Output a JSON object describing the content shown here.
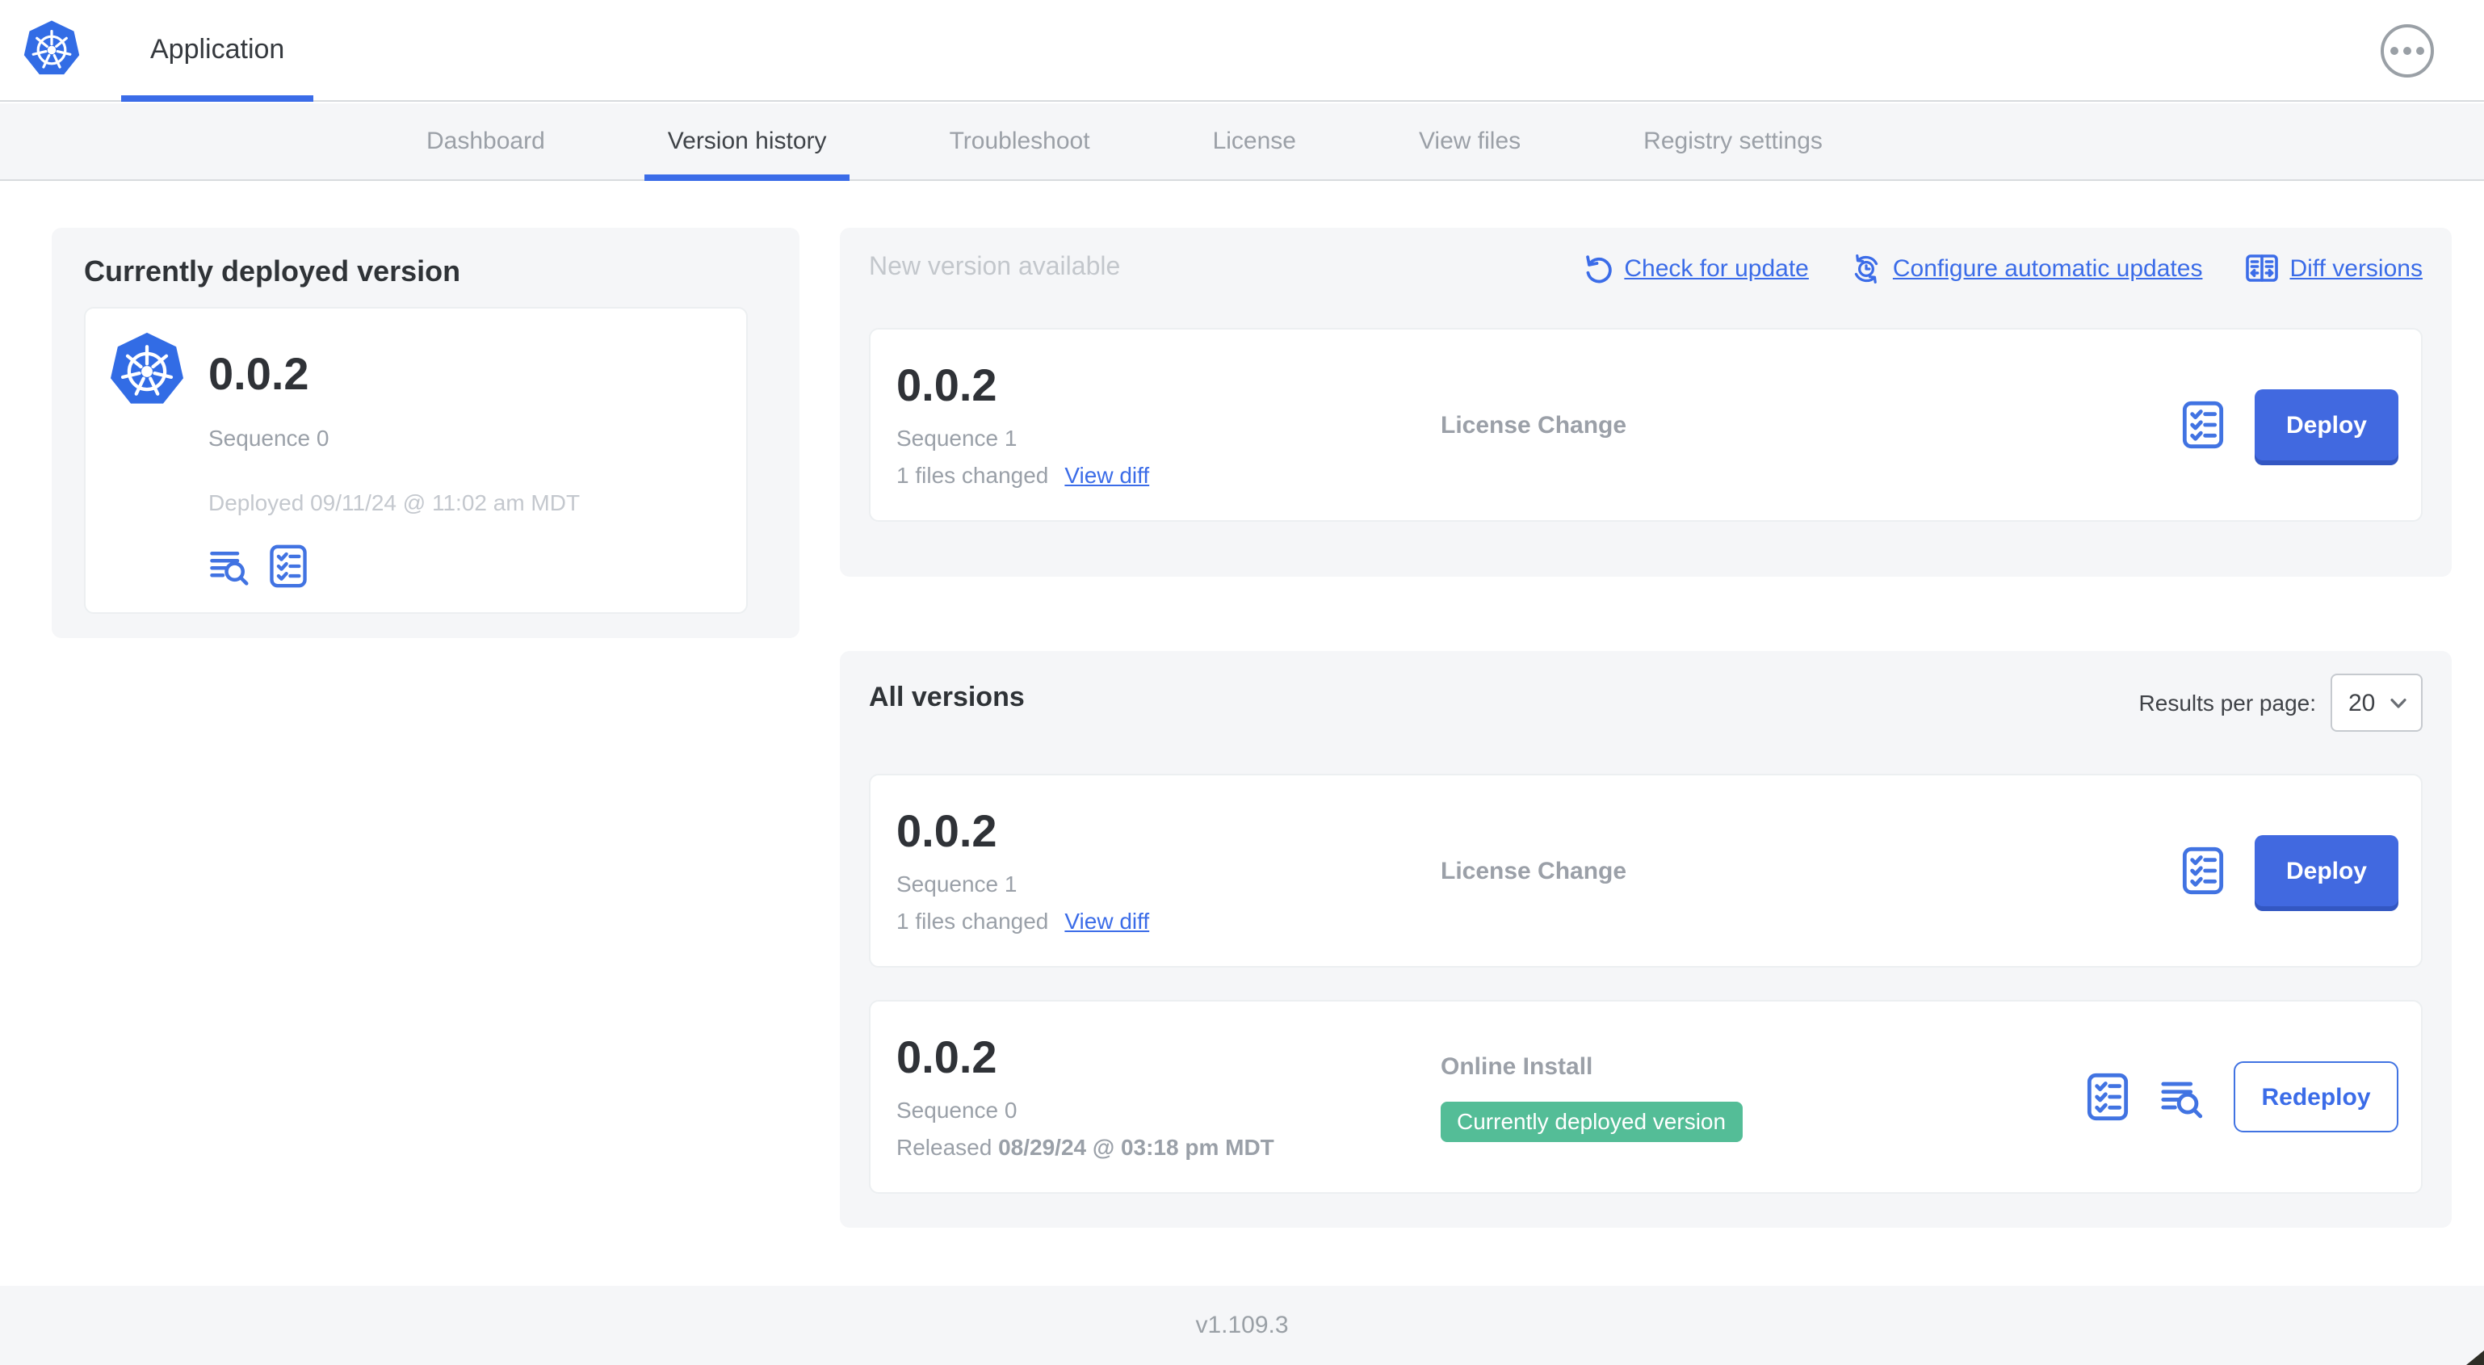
{
  "header": {
    "app_title": "Application"
  },
  "nav": {
    "tabs": [
      {
        "label": "Dashboard",
        "active": false
      },
      {
        "label": "Version history",
        "active": true
      },
      {
        "label": "Troubleshoot",
        "active": false
      },
      {
        "label": "License",
        "active": false
      },
      {
        "label": "View files",
        "active": false
      },
      {
        "label": "Registry settings",
        "active": false
      }
    ]
  },
  "currently_deployed": {
    "heading": "Currently deployed version",
    "version": "0.0.2",
    "sequence": "Sequence 0",
    "deployed_at": "Deployed 09/11/24 @ 11:02 am MDT"
  },
  "new_version": {
    "heading": "New version available",
    "check_for_update": "Check for update",
    "configure_automatic_updates": "Configure automatic updates",
    "diff_versions": "Diff versions",
    "card": {
      "version": "0.0.2",
      "sequence": "Sequence 1",
      "files_changed": "1 files changed",
      "view_diff": "View diff",
      "source": "License Change",
      "action": "Deploy"
    }
  },
  "all_versions": {
    "heading": "All versions",
    "results_per_page_label": "Results per page:",
    "results_per_page": "20",
    "rows": [
      {
        "version": "0.0.2",
        "sequence": "Sequence 1",
        "files_changed": "1 files changed",
        "view_diff": "View diff",
        "source": "License Change",
        "action": "Deploy"
      },
      {
        "version": "0.0.2",
        "sequence": "Sequence 0",
        "released_label": "Released",
        "released_date": "08/29/24 @ 03:18 pm MDT",
        "source": "Online Install",
        "badge": "Currently deployed version",
        "action": "Redeploy"
      }
    ]
  },
  "footer": {
    "version": "v1.109.3"
  },
  "icons": {
    "brand": "kubernetes-logo",
    "links": [
      "refresh-icon",
      "clock-refresh-icon",
      "diff-columns-icon"
    ],
    "row_actions": [
      "preflight-checklist-icon",
      "logs-icon"
    ],
    "header_right": "ellipsis-icon"
  },
  "colors": {
    "accent_blue": "#3b6ce8",
    "button_blue": "#4169e0",
    "kubernetes_blue": "#326ce5",
    "badge_green": "#54bd97",
    "panel_bg": "#f5f6f8"
  }
}
